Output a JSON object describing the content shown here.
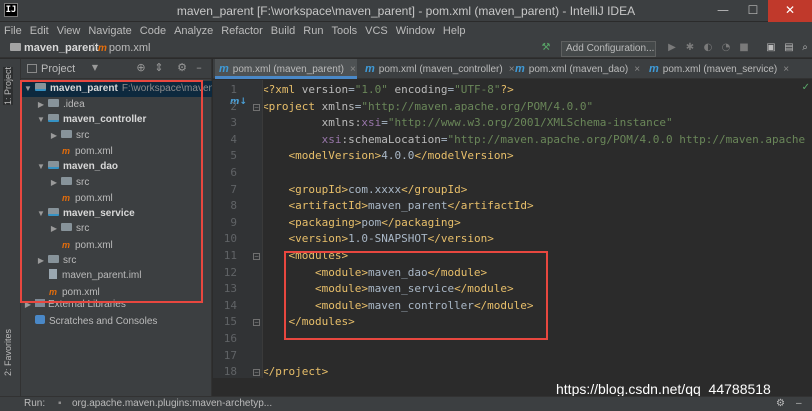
{
  "window": {
    "title": "maven_parent [F:\\workspace\\maven_parent] - pom.xml (maven_parent) - IntelliJ IDEA",
    "app_icon": "IJ",
    "controls": {
      "minimize": "—",
      "maximize": "☐",
      "close": "✕"
    }
  },
  "menu": [
    "File",
    "Edit",
    "View",
    "Navigate",
    "Code",
    "Analyze",
    "Refactor",
    "Build",
    "Run",
    "Tools",
    "VCS",
    "Window",
    "Help"
  ],
  "navbar": {
    "project": "maven_parent",
    "file": "pom.xml",
    "add_configuration": "Add Configuration..."
  },
  "left_strip": {
    "project_tab": "1: Project",
    "favorites_tab": "2: Favorites"
  },
  "project_panel": {
    "header": "Project",
    "tree": [
      {
        "label": "maven_parent",
        "hint": "F:\\workspace\\maven_",
        "kind": "module",
        "depth": 0,
        "expanded": true,
        "bold": true,
        "selected": true
      },
      {
        "label": ".idea",
        "kind": "folder",
        "depth": 1,
        "expanded": false
      },
      {
        "label": "maven_controller",
        "kind": "module",
        "depth": 1,
        "expanded": true,
        "bold": true
      },
      {
        "label": "src",
        "kind": "folder",
        "depth": 2,
        "expanded": false
      },
      {
        "label": "pom.xml",
        "kind": "maven",
        "depth": 2
      },
      {
        "label": "maven_dao",
        "kind": "module",
        "depth": 1,
        "expanded": true,
        "bold": true
      },
      {
        "label": "src",
        "kind": "folder",
        "depth": 2,
        "expanded": false
      },
      {
        "label": "pom.xml",
        "kind": "maven",
        "depth": 2
      },
      {
        "label": "maven_service",
        "kind": "module",
        "depth": 1,
        "expanded": true,
        "bold": true
      },
      {
        "label": "src",
        "kind": "folder",
        "depth": 2,
        "expanded": false
      },
      {
        "label": "pom.xml",
        "kind": "maven",
        "depth": 2
      },
      {
        "label": "src",
        "kind": "folder",
        "depth": 1,
        "expanded": false
      },
      {
        "label": "maven_parent.iml",
        "kind": "iml",
        "depth": 1
      },
      {
        "label": "pom.xml",
        "kind": "maven",
        "depth": 1
      }
    ],
    "external_libraries": "External Libraries",
    "scratches": "Scratches and Consoles"
  },
  "tabs": [
    {
      "label": "pom.xml (maven_parent)",
      "active": true
    },
    {
      "label": "pom.xml (maven_controller)",
      "active": false
    },
    {
      "label": "pom.xml (maven_dao)",
      "active": false
    },
    {
      "label": "pom.xml (maven_service)",
      "active": false
    }
  ],
  "editor": {
    "line_numbers": [
      "1",
      "2",
      "3",
      "4",
      "5",
      "6",
      "7",
      "8",
      "9",
      "10",
      "11",
      "12",
      "13",
      "14",
      "15",
      "16",
      "17",
      "18"
    ],
    "lines": [
      [
        [
          "pi",
          "<?xml "
        ],
        [
          "attr",
          "version"
        ],
        [
          "txt",
          "="
        ],
        [
          "val",
          "\"1.0\""
        ],
        [
          "txt",
          " "
        ],
        [
          "attr",
          "encoding"
        ],
        [
          "txt",
          "="
        ],
        [
          "val",
          "\"UTF-8\""
        ],
        [
          "pi",
          "?>"
        ]
      ],
      [
        [
          "tag",
          "<project "
        ],
        [
          "attr",
          "xmlns"
        ],
        [
          "txt",
          "="
        ],
        [
          "val",
          "\"http://maven.apache.org/POM/4.0.0\""
        ]
      ],
      [
        [
          "txt",
          "         "
        ],
        [
          "attr",
          "xmlns:"
        ],
        [
          "ns",
          "xsi"
        ],
        [
          "txt",
          "="
        ],
        [
          "val",
          "\"http://www.w3.org/2001/XMLSchema-instance\""
        ]
      ],
      [
        [
          "txt",
          "         "
        ],
        [
          "ns",
          "xsi"
        ],
        [
          "attr",
          ":schemaLocation"
        ],
        [
          "txt",
          "="
        ],
        [
          "val",
          "\"http://maven.apache.org/POM/4.0.0 http://maven.apache"
        ]
      ],
      [
        [
          "txt",
          "    "
        ],
        [
          "tag",
          "<modelVersion>"
        ],
        [
          "txt",
          "4.0.0"
        ],
        [
          "tag",
          "</modelVersion>"
        ]
      ],
      [],
      [
        [
          "txt",
          "    "
        ],
        [
          "tag",
          "<groupId>"
        ],
        [
          "txt",
          "com.xxxx"
        ],
        [
          "tag",
          "</groupId>"
        ]
      ],
      [
        [
          "txt",
          "    "
        ],
        [
          "tag",
          "<artifactId>"
        ],
        [
          "txt",
          "maven_parent"
        ],
        [
          "tag",
          "</artifactId>"
        ]
      ],
      [
        [
          "txt",
          "    "
        ],
        [
          "tag",
          "<packaging>"
        ],
        [
          "txt",
          "pom"
        ],
        [
          "tag",
          "</packaging>"
        ]
      ],
      [
        [
          "txt",
          "    "
        ],
        [
          "tag",
          "<version>"
        ],
        [
          "txt",
          "1.0-SNAPSHOT"
        ],
        [
          "tag",
          "</version>"
        ]
      ],
      [
        [
          "txt",
          "    "
        ],
        [
          "tag",
          "<modules>"
        ]
      ],
      [
        [
          "txt",
          "        "
        ],
        [
          "tag",
          "<module>"
        ],
        [
          "txt",
          "maven_dao"
        ],
        [
          "tag",
          "</module>"
        ]
      ],
      [
        [
          "txt",
          "        "
        ],
        [
          "tag",
          "<module>"
        ],
        [
          "txt",
          "maven_service"
        ],
        [
          "tag",
          "</module>"
        ]
      ],
      [
        [
          "txt",
          "        "
        ],
        [
          "tag",
          "<module>"
        ],
        [
          "txt",
          "maven_controller"
        ],
        [
          "tag",
          "</module>"
        ]
      ],
      [
        [
          "txt",
          "    "
        ],
        [
          "tag",
          "</modules>"
        ]
      ],
      [],
      [],
      [
        [
          "tag",
          "</project>"
        ]
      ]
    ]
  },
  "run_bar": {
    "label": "Run:",
    "item": "org.apache.maven.plugins:maven-archetyp..."
  },
  "watermark": "https://blog.csdn.net/qq_44788518",
  "colors": {
    "accent": "#4a88c7",
    "highlight_box": "#e8473f",
    "tag": "#e8bf6a",
    "string": "#6a8759"
  }
}
